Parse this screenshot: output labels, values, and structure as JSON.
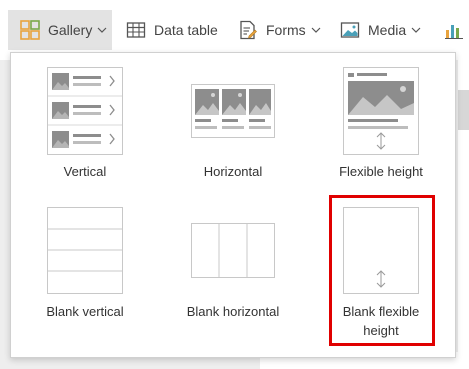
{
  "toolbar": {
    "gallery_label": "Gallery",
    "data_table_label": "Data table",
    "forms_label": "Forms",
    "media_label": "Media",
    "icons": [
      "gallery-icon",
      "data-table-icon",
      "forms-icon",
      "media-icon",
      "chart-icon"
    ]
  },
  "gallery_menu": {
    "items": [
      {
        "label": "Vertical",
        "icon": "vertical-gallery-icon"
      },
      {
        "label": "Horizontal",
        "icon": "horizontal-gallery-icon"
      },
      {
        "label": "Flexible height",
        "icon": "flexible-height-gallery-icon"
      },
      {
        "label": "Blank vertical",
        "icon": "blank-vertical-gallery-icon"
      },
      {
        "label": "Blank horizontal",
        "icon": "blank-horizontal-gallery-icon"
      },
      {
        "label": "Blank flexible height",
        "icon": "blank-flexible-height-gallery-icon",
        "selected": true
      }
    ]
  },
  "colors": {
    "accent_gallery_icon": "#e8a33d",
    "thumbnail_fill": "#8d8d8d",
    "selection_border": "#e00000",
    "hover_bg": "#e3e3e3"
  }
}
